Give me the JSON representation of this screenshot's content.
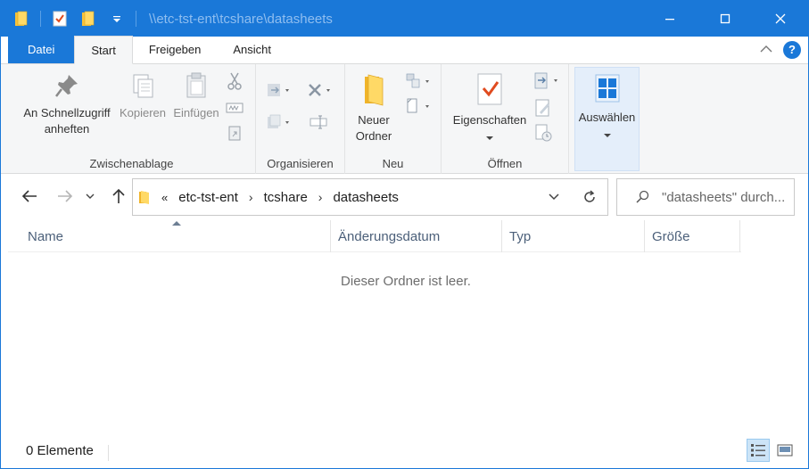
{
  "window": {
    "title": "\\\\etc-tst-ent\\tcshare\\datasheets"
  },
  "colors": {
    "accent": "#1a78d8",
    "folder": "#f8c23a",
    "check": "#e04b1f"
  },
  "tabs": [
    {
      "label": "Datei"
    },
    {
      "label": "Start"
    },
    {
      "label": "Freigeben"
    },
    {
      "label": "Ansicht"
    }
  ],
  "ribbon": {
    "clipboard": {
      "pin_label_1": "An Schnellzugriff",
      "pin_label_2": "anheften",
      "copy_label": "Kopieren",
      "paste_label": "Einfügen",
      "group_label": "Zwischenablage"
    },
    "organize": {
      "group_label": "Organisieren"
    },
    "new": {
      "folder_label_1": "Neuer",
      "folder_label_2": "Ordner",
      "group_label": "Neu"
    },
    "open": {
      "properties_label": "Eigenschaften",
      "group_label": "Öffnen"
    },
    "select": {
      "label": "Auswählen"
    }
  },
  "address": {
    "overflow": "«",
    "crumbs": [
      "etc-tst-ent",
      "tcshare",
      "datasheets"
    ]
  },
  "search": {
    "placeholder": "\"datasheets\" durch..."
  },
  "columns": [
    {
      "label": "Name"
    },
    {
      "label": "Änderungsdatum"
    },
    {
      "label": "Typ"
    },
    {
      "label": "Größe"
    }
  ],
  "content": {
    "empty_message": "Dieser Ordner ist leer."
  },
  "status": {
    "item_count": "0 Elemente"
  }
}
